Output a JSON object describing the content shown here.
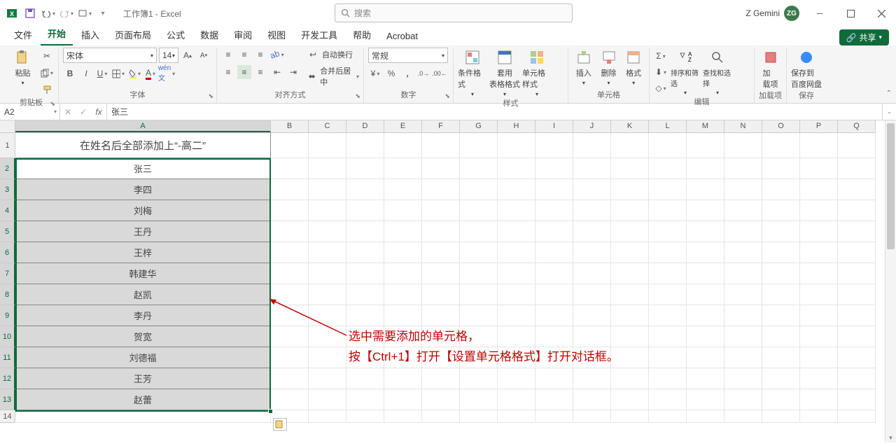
{
  "app": {
    "doc_title": "工作簿1 - Excel",
    "search_placeholder": "搜索",
    "user_name": "Z Gemini",
    "user_initials": "ZG"
  },
  "tabs": {
    "file": "文件",
    "home": "开始",
    "insert": "插入",
    "layout": "页面布局",
    "formulas": "公式",
    "data": "数据",
    "review": "审阅",
    "view": "视图",
    "dev": "开发工具",
    "help": "帮助",
    "acrobat": "Acrobat",
    "share": "共享"
  },
  "ribbon": {
    "clipboard": {
      "paste": "粘贴",
      "group": "剪贴板"
    },
    "font": {
      "name": "宋体",
      "size": "14",
      "group": "字体"
    },
    "align": {
      "wrap": "自动换行",
      "merge": "合并后居中",
      "group": "对齐方式"
    },
    "number": {
      "format": "常规",
      "group": "数字"
    },
    "styles": {
      "cond": "条件格式",
      "table": "套用\n表格格式",
      "cell": "单元格样式",
      "group": "样式"
    },
    "cells": {
      "insert": "插入",
      "delete": "删除",
      "format": "格式",
      "group": "单元格"
    },
    "editing": {
      "sort": "排序和筛选",
      "find": "查找和选择",
      "group": "编辑"
    },
    "addins": {
      "btn": "加\n载项",
      "group": "加载项"
    },
    "save": {
      "btn": "保存到\n百度网盘",
      "group": "保存"
    }
  },
  "formula_bar": {
    "ref": "A2",
    "content": "张三"
  },
  "columns": [
    "A",
    "B",
    "C",
    "D",
    "E",
    "F",
    "G",
    "H",
    "I",
    "J",
    "K",
    "L",
    "M",
    "N",
    "O",
    "P",
    "Q"
  ],
  "col_a_width": 365,
  "rest_width": 54,
  "rows": {
    "header": "在姓名后全部添加上“-高二”",
    "data": [
      "张三",
      "李四",
      "刘梅",
      "王丹",
      "王梓",
      "韩建华",
      "赵凯",
      "李丹",
      "贺宽",
      "刘德福",
      "王芳",
      "赵蕾"
    ]
  },
  "annotation": {
    "line1": "选中需要添加的单元格，",
    "line2": "按【Ctrl+1】打开【设置单元格格式】打开对话框。"
  }
}
